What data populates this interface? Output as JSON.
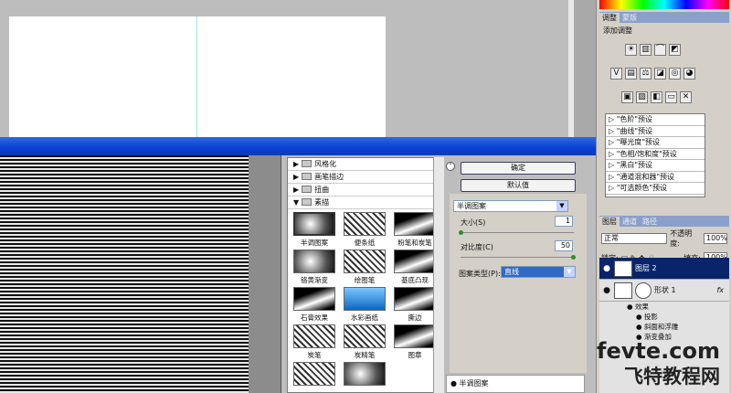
{
  "adjustments_panel": {
    "tabs": [
      "调整",
      "蒙版"
    ],
    "title": "添加调整",
    "presets": [
      "\"色阶\"预设",
      "\"曲线\"预设",
      "\"曝光度\"预设",
      "\"色相/饱和度\"预设",
      "\"黑白\"预设",
      "\"通道混和器\"预设",
      "\"可选颜色\"预设"
    ]
  },
  "layers_panel": {
    "tabs": [
      "图层",
      "通道",
      "路径"
    ],
    "blend_mode": "正常",
    "opacity_label": "不透明度:",
    "opacity_value": "100%",
    "lock_label": "锁定:",
    "fill_label": "填充:",
    "fill_value": "100%",
    "layers": [
      "图层 2",
      "形状 1"
    ],
    "fx_label": "fx",
    "effects_label": "效果",
    "effects": [
      "投影",
      "斜面和浮雕",
      "渐变叠加"
    ]
  },
  "filter_gallery": {
    "categories": [
      "风格化",
      "画笔描边",
      "扭曲",
      "素描"
    ],
    "thumbnails": [
      "半调图案",
      "便条纸",
      "粉笔和炭笔",
      "铬黄渐变",
      "绘图笔",
      "基底凸现",
      "石膏效果",
      "水彩画纸",
      "撕边",
      "炭笔",
      "炭精笔",
      "图章",
      "",
      ""
    ],
    "ok_label": "确定",
    "default_label": "默认值",
    "selected_filter": "半调图案",
    "size_label": "大小(S)",
    "size_value": "1",
    "contrast_label": "对比度(C)",
    "contrast_value": "50",
    "pattern_type_label": "图案类型(P):",
    "pattern_type_value": "直线",
    "effect_layer_label": "半调图案"
  },
  "watermark": {
    "line1": "fevte.com",
    "line2": "飞特教程网"
  },
  "colors": {
    "title_bar": "#0a3fd1",
    "selection": "#0a246a"
  }
}
